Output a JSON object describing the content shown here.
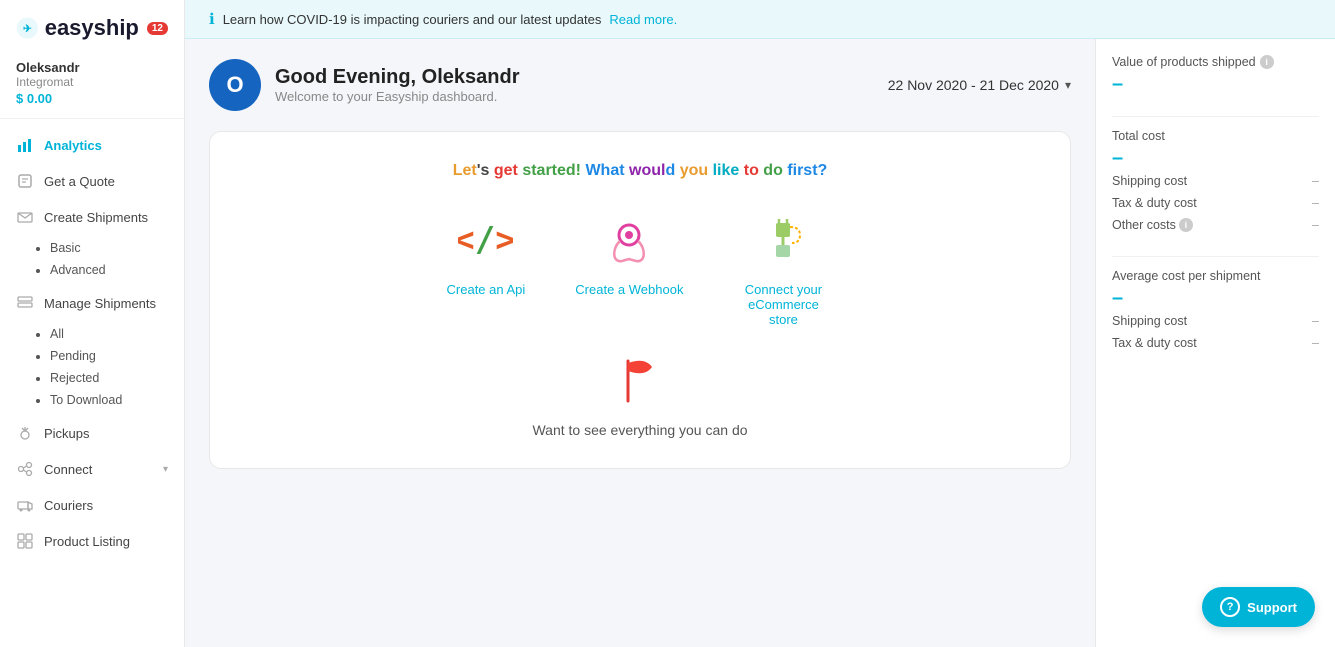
{
  "app": {
    "name": "easyship",
    "badge": "12"
  },
  "user": {
    "name": "Oleksandr",
    "company": "Integromat",
    "balance": "$ 0.00",
    "avatar_letter": "O"
  },
  "banner": {
    "text": "Learn how COVID-19 is impacting couriers and our latest updates",
    "link": "Read more."
  },
  "greeting": {
    "title": "Good Evening, Oleksandr",
    "subtitle": "Welcome to your Easyship dashboard."
  },
  "date_range": {
    "text": "22 Nov 2020  -  21 Dec 2020"
  },
  "get_started": {
    "title": "Let's get started! What would you like to do first?",
    "actions": [
      {
        "label": "Create an Api",
        "type": "api"
      },
      {
        "label": "Create a Webhook",
        "type": "webhook"
      },
      {
        "label": "Connect your eCommerce store",
        "type": "ecommerce"
      }
    ],
    "flag_label": "Want to see everything you can do"
  },
  "nav": {
    "items": [
      {
        "id": "analytics",
        "label": "Analytics",
        "active": true
      },
      {
        "id": "get-a-quote",
        "label": "Get a Quote",
        "active": false
      },
      {
        "id": "create-shipments",
        "label": "Create Shipments",
        "active": false,
        "sub": [
          "Basic",
          "Advanced"
        ]
      },
      {
        "id": "manage-shipments",
        "label": "Manage Shipments",
        "active": false,
        "sub": [
          "All",
          "Pending",
          "Rejected",
          "To Download"
        ]
      },
      {
        "id": "pickups",
        "label": "Pickups",
        "active": false
      },
      {
        "id": "connect",
        "label": "Connect",
        "active": false,
        "hasChevron": true
      },
      {
        "id": "couriers",
        "label": "Couriers",
        "active": false
      },
      {
        "id": "product-listing",
        "label": "Product Listing",
        "active": false
      }
    ]
  },
  "stats": {
    "products_shipped_label": "Value of products shipped",
    "products_shipped_value": "–",
    "total_cost_label": "Total cost",
    "total_cost_value": "–",
    "shipping_cost_label": "Shipping cost",
    "shipping_cost_value": "–",
    "tax_duty_label": "Tax & duty cost",
    "tax_duty_value": "–",
    "other_costs_label": "Other costs",
    "other_costs_value": "–",
    "avg_cost_label": "Average cost per shipment",
    "avg_cost_value": "–",
    "avg_shipping_label": "Shipping cost",
    "avg_shipping_value": "–",
    "avg_tax_label": "Tax & duty cost",
    "avg_tax_value": "–"
  },
  "support_btn": "Support"
}
